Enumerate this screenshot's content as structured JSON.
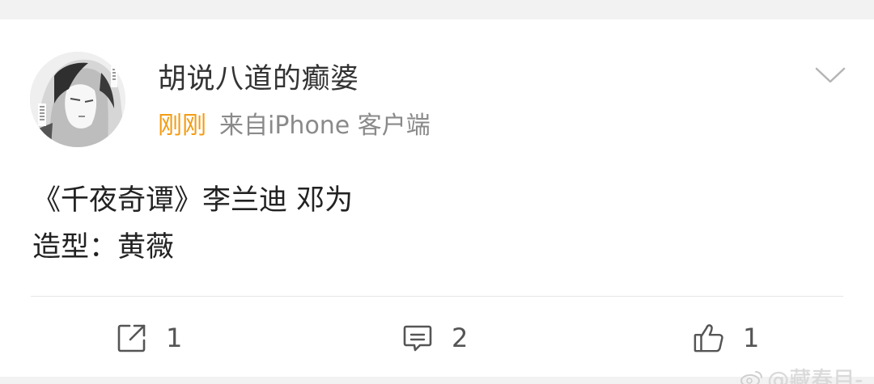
{
  "post": {
    "author_name": "胡说八道的癫婆",
    "time_label": "刚刚",
    "source_label": "来自iPhone 客户端",
    "content_lines": [
      "《千夜奇谭》李兰迪 邓为",
      "造型：黄薇"
    ]
  },
  "actions": {
    "repost_count": "1",
    "comment_count": "2",
    "like_count": "1"
  },
  "watermark": {
    "text": "@藏春目-"
  },
  "colors": {
    "time": "#f39c12",
    "source": "#8a8a8a",
    "text": "#222222",
    "background": "#f2f2f2"
  },
  "icons": {
    "repost": "repost-icon",
    "comment": "comment-icon",
    "like": "thumb-up-icon",
    "menu": "chevron-down-icon"
  }
}
